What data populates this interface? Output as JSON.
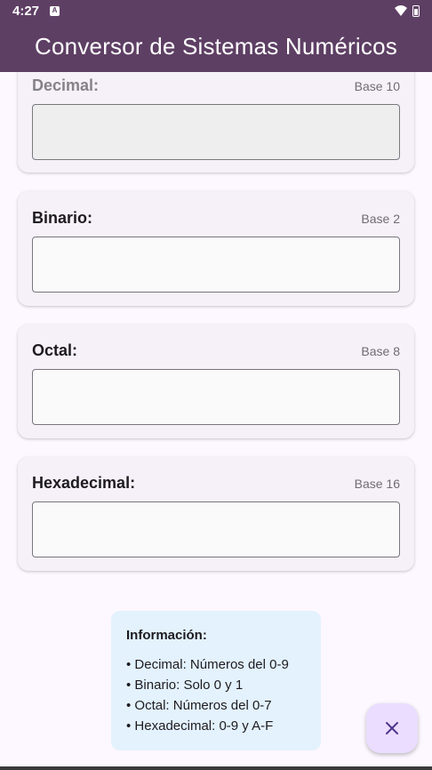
{
  "status_bar": {
    "time": "4:27",
    "notif_glyph": "A"
  },
  "app_bar": {
    "title": "Conversor de Sistemas Numéricos"
  },
  "cards": [
    {
      "title": "Decimal:",
      "base": "Base 10",
      "value": ""
    },
    {
      "title": "Binario:",
      "base": "Base 2",
      "value": ""
    },
    {
      "title": "Octal:",
      "base": "Base 8",
      "value": ""
    },
    {
      "title": "Hexadecimal:",
      "base": "Base 16",
      "value": ""
    }
  ],
  "info": {
    "title": "Información:",
    "items": [
      "Decimal: Números del 0-9",
      "Binario: Solo 0 y 1",
      "Octal: Números del 0-7",
      "Hexadecimal: 0-9 y A-F"
    ]
  },
  "fab": {
    "icon": "close-icon"
  },
  "colors": {
    "app_bar": "#5e3f64",
    "card": "#f6f1f9",
    "info_box": "#e3f2fd",
    "fab": "#eaddff"
  }
}
